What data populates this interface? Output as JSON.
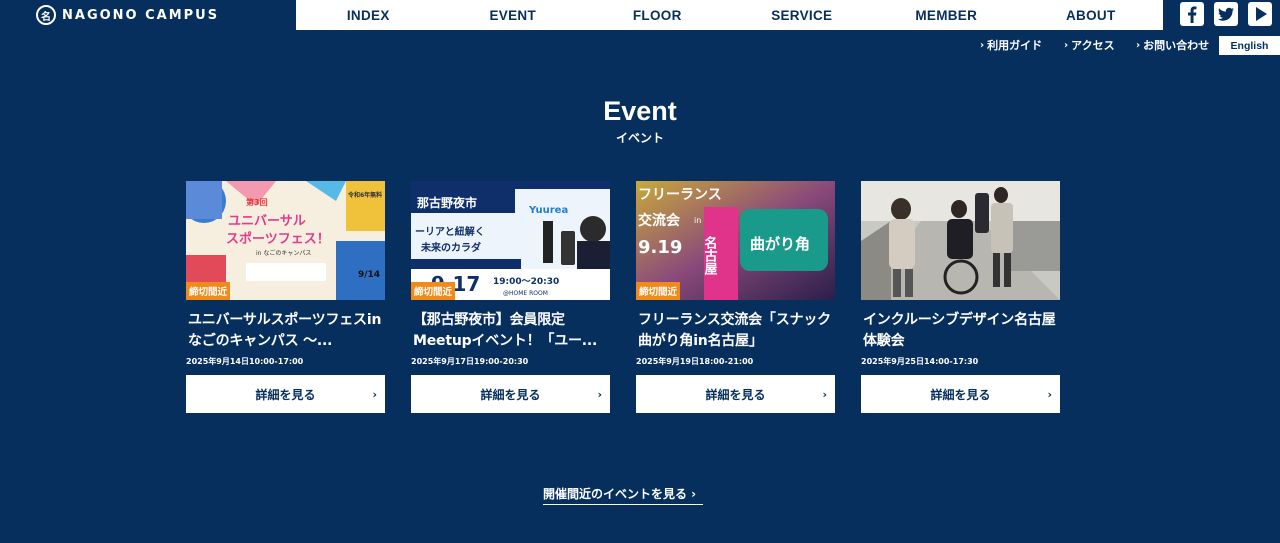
{
  "header": {
    "logo_text": "NAGONO CAMPUS",
    "logo_glyph": "名",
    "nav": [
      "INDEX",
      "EVENT",
      "FLOOR",
      "SERVICE",
      "MEMBER",
      "ABOUT"
    ],
    "social": [
      "facebook-icon",
      "twitter-icon",
      "youtube-icon"
    ],
    "subnav": [
      "利用ガイド",
      "アクセス",
      "お問い合わせ"
    ],
    "subnav_chevron": "›",
    "language": "English"
  },
  "section": {
    "title": "Event",
    "subtitle": "イベント"
  },
  "events": [
    {
      "title": "ユニバーサルスポーツフェスinなごのキャンパス ～...",
      "date": "2025年9月14日10:00-17:00",
      "badge": "締切間近",
      "button": "詳細を見る",
      "thumb_text": [
        "令和6年無料",
        "第3回",
        "ユニバーサル",
        "スポーツフェス！",
        "in なごのキャンパス",
        "9/14"
      ]
    },
    {
      "title": "【那古野夜市】会員限定Meetupイベント！「ユー...",
      "date": "2025年9月17日19:00-20:30",
      "badge": "締切間近",
      "button": "詳細を見る",
      "thumb_text": [
        "那古野夜市",
        "Yuurea",
        "ーリアと紐解く",
        "未来のカラダ",
        "9.17",
        "19:00〜20:30",
        "@HOME ROOM"
      ]
    },
    {
      "title": "フリーランス交流会「スナック曲がり角in名古屋」",
      "date": "2025年9月19日18:00-21:00",
      "badge": "締切間近",
      "button": "詳細を見る",
      "thumb_text": [
        "フリーランス",
        "交流会",
        "9.19",
        "in",
        "名古屋",
        "曲がり角"
      ]
    },
    {
      "title": "インクルーシブデザイン名古屋体験会",
      "date": "2025年9月25日14:00-17:30",
      "badge": "",
      "button": "詳細を見る",
      "thumb_text": []
    }
  ],
  "more_link": "開催間近のイベントを見る ›",
  "colors": {
    "background": "#062f5e",
    "accent": "#f08a1a",
    "white": "#ffffff"
  }
}
